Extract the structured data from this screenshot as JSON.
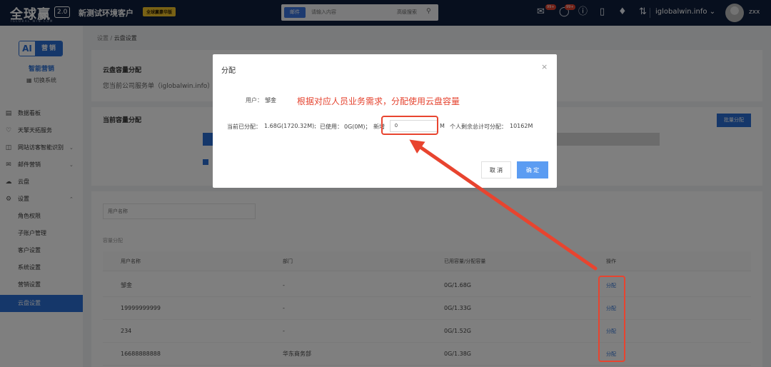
{
  "topbar": {
    "logo": "全球赢",
    "logo_sub": "IGLOBAL WIN.COM",
    "version": "2.0",
    "env_name": "新测试环境客户",
    "edition": "全球赢豪华版",
    "search_tag": "邮件",
    "search_placeholder": "请输入内容",
    "search_advanced": "高级搜索",
    "mail_badge": "99+",
    "chat_badge": "99+",
    "domain": "iglobalwin.info",
    "user": "zxx"
  },
  "sidebar": {
    "ai_logo_ai": "AI",
    "ai_logo_text": "营销",
    "brand": "智能营销",
    "switch": "切换系统",
    "items": [
      {
        "label": "数据看板",
        "icon": "dashboard-icon"
      },
      {
        "label": "天擎天拓服务",
        "icon": "heart-icon"
      },
      {
        "label": "网站访客智能识别",
        "icon": "monitor-icon"
      },
      {
        "label": "邮件营销",
        "icon": "mail-icon"
      },
      {
        "label": "云盘",
        "icon": "cloud-icon"
      },
      {
        "label": "设置",
        "icon": "gear-icon"
      },
      {
        "label": "角色权限"
      },
      {
        "label": "子账户管理"
      },
      {
        "label": "客户设置"
      },
      {
        "label": "系统设置"
      },
      {
        "label": "营销设置"
      },
      {
        "label": "云盘设置"
      }
    ]
  },
  "breadcrumb": {
    "root": "设置",
    "sep": "/",
    "current": "云盘设置"
  },
  "capacity_card": {
    "title": "云盘容量分配",
    "subtitle": "您当前公司服务单（iglobalwin.info）"
  },
  "current_card": {
    "title": "当前容量分配",
    "batch_button": "批量分配",
    "used_fraction": 0.03
  },
  "list": {
    "filter_placeholder": "用户名称",
    "section_label": "容量分配",
    "columns": [
      "用户名称",
      "部门",
      "已用容量/分配容量",
      "操作"
    ],
    "rows": [
      {
        "name": "邹金",
        "dept": "-",
        "usage": "0G/1.68G",
        "action": "分配"
      },
      {
        "name": "19999999999",
        "dept": "-",
        "usage": "0G/1.33G",
        "action": "分配"
      },
      {
        "name": "234",
        "dept": "-",
        "usage": "0G/1.52G",
        "action": "分配"
      },
      {
        "name": "16688888888",
        "dept": "华东商务部",
        "usage": "0G/1.38G",
        "action": "分配"
      }
    ]
  },
  "dialog": {
    "title": "分配",
    "close": "×",
    "user_label": "用户：",
    "user_value": "邹金",
    "note": "根据对应人员业务需求，分配使用云盘容量",
    "allocated_label": "当前已分配：",
    "allocated_value": "1.68G(1720.32M);",
    "used_label": "已使用：",
    "used_value": "0G(0M)；",
    "add_label": "新增",
    "add_value": "0",
    "unit": "M",
    "remaining_label": "个人剩余总计可分配：",
    "remaining_value": "10162M",
    "cancel": "取 消",
    "confirm": "确 定"
  },
  "colors": {
    "accent": "#2a6fd4",
    "annotation": "#e8442f",
    "topbar": "#0e1e3c"
  }
}
